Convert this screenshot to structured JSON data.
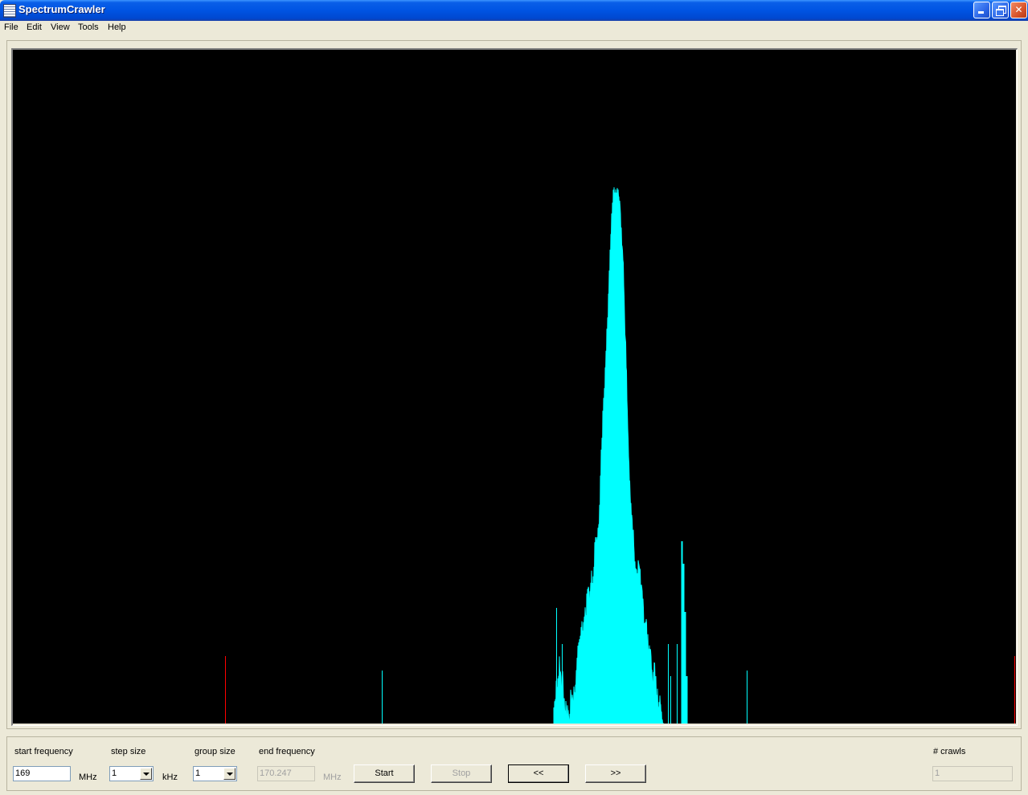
{
  "window": {
    "title": "SpectrumCrawler",
    "icon": "app-window-icon"
  },
  "menu": {
    "items": [
      "File",
      "Edit",
      "View",
      "Tools",
      "Help"
    ]
  },
  "colors": {
    "trace": "#00ffff",
    "marker": "#ff0000",
    "background": "#000000"
  },
  "controls": {
    "start_frequency": {
      "label": "start frequency",
      "value": "169",
      "unit": "MHz"
    },
    "step_size": {
      "label": "step size",
      "value": "1",
      "unit": "kHz"
    },
    "group_size": {
      "label": "group size",
      "value": "1"
    },
    "end_frequency": {
      "label": "end frequency",
      "value": "170.247",
      "unit": "MHz"
    },
    "start_button": "Start",
    "stop_button": "Stop",
    "prev_button": "<<",
    "next_button": ">>",
    "crawls": {
      "label": "# crawls",
      "value": "1"
    }
  }
}
